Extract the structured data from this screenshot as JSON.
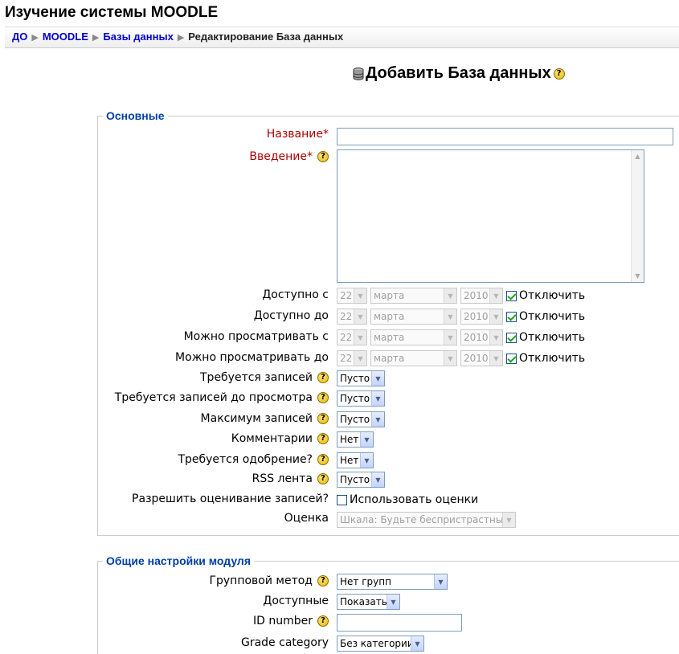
{
  "site_title": "Изучение системы MOODLE",
  "breadcrumb": [
    {
      "label": "ДО",
      "link": true
    },
    {
      "label": "MOODLE",
      "link": true
    },
    {
      "label": "Базы данных",
      "link": true
    },
    {
      "label": "Редактирование База данных",
      "link": false
    }
  ],
  "heading": "Добавить База данных",
  "section_general": {
    "legend": "Основные",
    "name_label": "Название*",
    "name_value": "",
    "intro_label": "Введение*",
    "available_from": {
      "label": "Доступно с",
      "day": "22",
      "month": "марта",
      "year": "2010",
      "disable_label": "Отключить",
      "disabled": true
    },
    "available_to": {
      "label": "Доступно до",
      "day": "22",
      "month": "марта",
      "year": "2010",
      "disable_label": "Отключить",
      "disabled": true
    },
    "view_from": {
      "label": "Можно просматривать с",
      "day": "22",
      "month": "марта",
      "year": "2010",
      "disable_label": "Отключить",
      "disabled": true
    },
    "view_to": {
      "label": "Можно просматривать до",
      "day": "22",
      "month": "марта",
      "year": "2010",
      "disable_label": "Отключить",
      "disabled": true
    },
    "required_entries": {
      "label": "Требуется записей",
      "value": "Пусто"
    },
    "required_entries_view": {
      "label": "Требуется записей до просмотра",
      "value": "Пусто"
    },
    "max_entries": {
      "label": "Максимум записей",
      "value": "Пусто"
    },
    "comments": {
      "label": "Комментарии",
      "value": "Нет"
    },
    "approval": {
      "label": "Требуется одобрение?",
      "value": "Нет"
    },
    "rss": {
      "label": "RSS лента",
      "value": "Пусто"
    },
    "allow_rating": {
      "label": "Разрешить оценивание записей?",
      "checkbox_label": "Использовать оценки",
      "checked": false
    },
    "grade": {
      "label": "Оценка",
      "value": "Шкала: Будьте беспристрастным"
    }
  },
  "section_module": {
    "legend": "Общие настройки модуля",
    "group_mode": {
      "label": "Групповой метод",
      "value": "Нет групп"
    },
    "visible": {
      "label": "Доступные",
      "value": "Показать"
    },
    "id_number": {
      "label": "ID number",
      "value": ""
    },
    "grade_category": {
      "label": "Grade category",
      "value": "Без категории"
    }
  },
  "help_icon_symbol": "?",
  "colors": {
    "link": "#0000cc",
    "required": "#aa0000",
    "legend": "#003fa5"
  }
}
